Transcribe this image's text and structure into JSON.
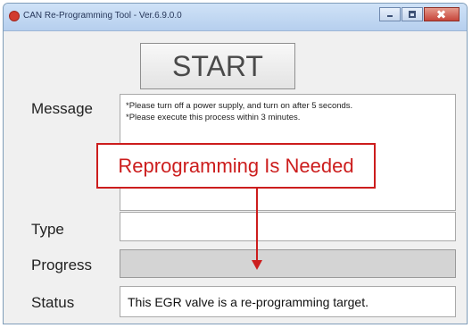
{
  "window": {
    "title": "CAN Re-Programming Tool - Ver.6.9.0.0"
  },
  "start_button": {
    "label": "START"
  },
  "message": {
    "label": "Message",
    "lines": [
      "*Please turn off a power supply, and turn on after 5 seconds.",
      "*Please execute this process within 3 minutes."
    ]
  },
  "callout": {
    "text": "Reprogramming Is Needed"
  },
  "type": {
    "label": "Type",
    "value": ""
  },
  "progress": {
    "label": "Progress",
    "value": 0
  },
  "status": {
    "label": "Status",
    "value": "This EGR valve is a re-programming target."
  },
  "colors": {
    "callout": "#cc1d1d",
    "title_bar": "#b6cfee"
  }
}
